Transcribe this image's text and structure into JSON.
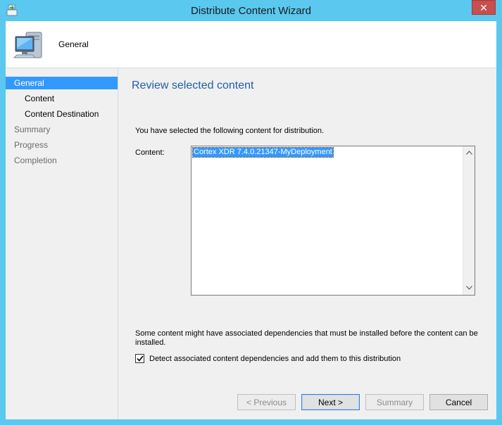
{
  "window": {
    "title": "Distribute Content Wizard",
    "close_label": "✕"
  },
  "header": {
    "title": "General"
  },
  "nav": {
    "items": [
      {
        "label": "General"
      },
      {
        "label": "Content"
      },
      {
        "label": "Content Destination"
      },
      {
        "label": "Summary"
      },
      {
        "label": "Progress"
      },
      {
        "label": "Completion"
      }
    ]
  },
  "main": {
    "title": "Review selected content",
    "intro": "You have selected the following content for distribution.",
    "content_label": "Content:",
    "content_items": [
      "Cortex XDR 7.4.0.21347-MyDeployment"
    ],
    "dependency_note": "Some content might have associated dependencies that must be installed before the content can be installed.",
    "checkbox": {
      "label": "Detect associated content dependencies and add them to this distribution",
      "checked": true
    }
  },
  "buttons": {
    "previous": "< Previous",
    "next": "Next >",
    "summary": "Summary",
    "cancel": "Cancel"
  }
}
